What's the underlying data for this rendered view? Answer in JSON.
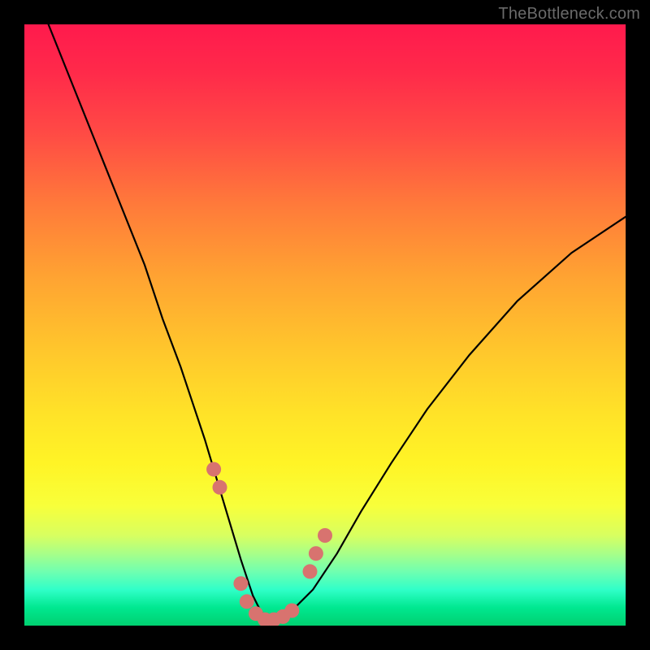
{
  "watermark": "TheBottleneck.com",
  "chart_data": {
    "type": "line",
    "title": "",
    "xlabel": "",
    "ylabel": "",
    "xlim": [
      0,
      100
    ],
    "ylim": [
      0,
      100
    ],
    "series": [
      {
        "name": "curve",
        "x": [
          4,
          8,
          12,
          16,
          20,
          23,
          26,
          28,
          30,
          31.5,
          33,
          34.5,
          36,
          37,
          38,
          39,
          40,
          41.5,
          43,
          45,
          48,
          52,
          56,
          61,
          67,
          74,
          82,
          91,
          100
        ],
        "y": [
          100,
          90,
          80,
          70,
          60,
          51,
          43,
          37,
          31,
          26,
          21,
          16,
          11,
          8,
          5,
          3,
          1.5,
          1,
          1.5,
          3,
          6,
          12,
          19,
          27,
          36,
          45,
          54,
          62,
          68
        ]
      }
    ],
    "markers": {
      "name": "highlight-dots",
      "color": "#d8736f",
      "points": [
        {
          "x": 31.5,
          "y": 26
        },
        {
          "x": 32.5,
          "y": 23
        },
        {
          "x": 36,
          "y": 7
        },
        {
          "x": 37,
          "y": 4
        },
        {
          "x": 38.5,
          "y": 2
        },
        {
          "x": 40,
          "y": 1
        },
        {
          "x": 41.5,
          "y": 1
        },
        {
          "x": 43,
          "y": 1.5
        },
        {
          "x": 44.5,
          "y": 2.5
        },
        {
          "x": 47.5,
          "y": 9
        },
        {
          "x": 48.5,
          "y": 12
        },
        {
          "x": 50,
          "y": 15
        }
      ]
    }
  }
}
